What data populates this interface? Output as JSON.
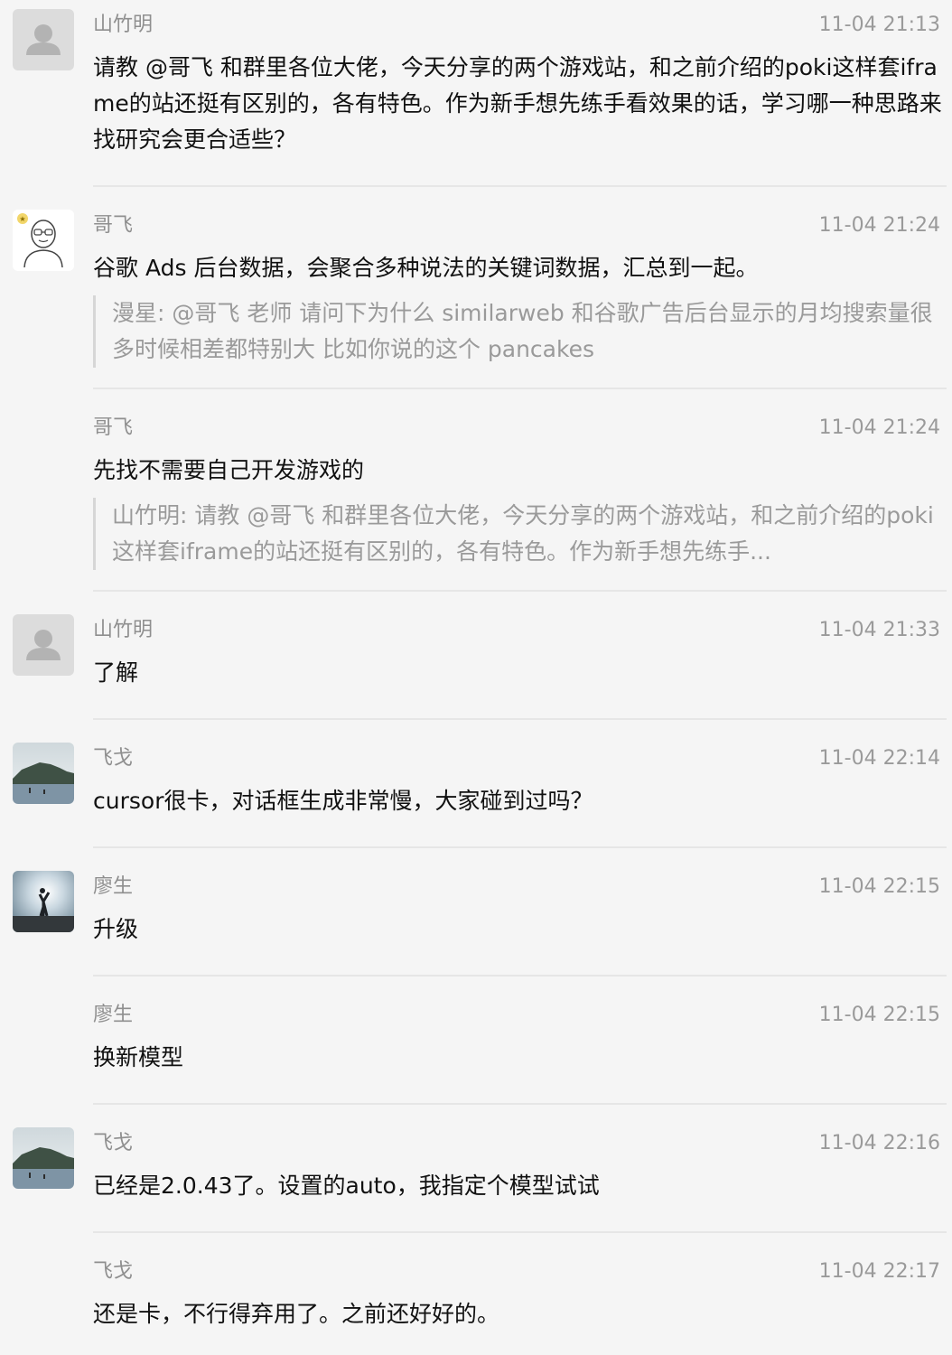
{
  "messages": [
    {
      "sender": "山竹明",
      "time": "11-04 21:13",
      "text": "请教 @哥飞 和群里各位大佬，今天分享的两个游戏站，和之前介绍的poki这样套iframe的站还挺有区别的，各有特色。作为新手想先练手看效果的话，学习哪一种思路来找研究会更合适些？"
    },
    {
      "sender": "哥飞",
      "time": "11-04 21:24",
      "text": "谷歌 Ads 后台数据，会聚合多种说法的关键词数据，汇总到一起。",
      "quote": "漫星: @哥飞  老师 请问下为什么 similarweb 和谷歌广告后台显示的月均搜索量很多时候相差都特别大  比如你说的这个 pancakes"
    },
    {
      "sender": "哥飞",
      "time": "11-04 21:24",
      "text": "先找不需要自己开发游戏的",
      "quote": "山竹明: 请教 @哥飞 和群里各位大佬，今天分享的两个游戏站，和之前介绍的poki这样套iframe的站还挺有区别的，各有特色。作为新手想先练手..."
    },
    {
      "sender": "山竹明",
      "time": "11-04 21:33",
      "text": "了解"
    },
    {
      "sender": "飞戈",
      "time": "11-04 22:14",
      "text": "cursor很卡，对话框生成非常慢，大家碰到过吗？"
    },
    {
      "sender": "廖生",
      "time": "11-04 22:15",
      "text": "升级"
    },
    {
      "sender": "廖生",
      "time": "11-04 22:15",
      "text": "换新模型"
    },
    {
      "sender": "飞戈",
      "time": "11-04 22:16",
      "text": "已经是2.0.43了。设置的auto，我指定个模型试试"
    },
    {
      "sender": "飞戈",
      "time": "11-04 22:17",
      "text": "还是卡，不行得弃用了。之前还好好的。"
    }
  ]
}
